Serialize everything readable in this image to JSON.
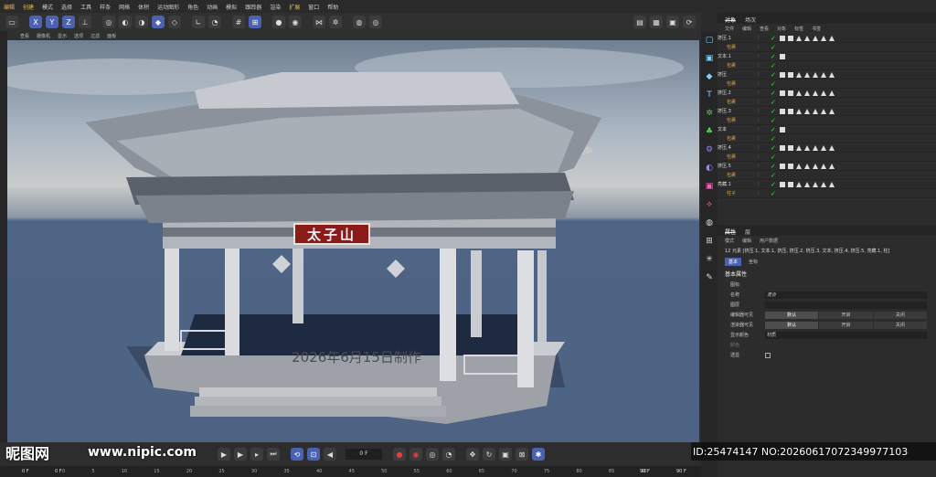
{
  "menubar": [
    "编辑",
    "创建",
    "模式",
    "选择",
    "工具",
    "样条",
    "网格",
    "体积",
    "运动图形",
    "角色",
    "动画",
    "模拟",
    "跟踪器",
    "渲染",
    "扩展",
    "窗口",
    "帮助"
  ],
  "viewport_menu": [
    "查看",
    "摄像机",
    "显示",
    "选项",
    "过滤",
    "面板"
  ],
  "scene": {
    "plaque_text": "太子山",
    "caption": "2026年6月15日制作"
  },
  "object_panel": {
    "tabs": [
      "对象",
      "场次"
    ],
    "menu": [
      "文件",
      "编辑",
      "查看",
      "对象",
      "标签",
      "书签"
    ],
    "rows": [
      {
        "name": "挤压.1",
        "type": "parent"
      },
      {
        "name": "包裹",
        "type": "child"
      },
      {
        "name": "文本.1",
        "type": "parent"
      },
      {
        "name": "包裹",
        "type": "child"
      },
      {
        "name": "挤压",
        "type": "parent"
      },
      {
        "name": "包裹",
        "type": "child"
      },
      {
        "name": "挤压.2",
        "type": "parent"
      },
      {
        "name": "包裹",
        "type": "child"
      },
      {
        "name": "挤压.3",
        "type": "parent"
      },
      {
        "name": "包裹",
        "type": "child"
      },
      {
        "name": "文本",
        "type": "parent"
      },
      {
        "name": "包裹",
        "type": "child"
      },
      {
        "name": "挤压.4",
        "type": "parent"
      },
      {
        "name": "包裹",
        "type": "child"
      },
      {
        "name": "挤压.5",
        "type": "parent"
      },
      {
        "name": "包裹",
        "type": "child"
      },
      {
        "name": "亮藏.1",
        "type": "parent"
      },
      {
        "name": "柱子",
        "type": "child"
      }
    ]
  },
  "attr_panel": {
    "tabs": [
      "属性",
      "层"
    ],
    "menu": [
      "模式",
      "编辑",
      "用户数据"
    ],
    "selection": "12 元素 [挤压.1, 文本.1, 挤压, 挤压.2, 挤压.3, 文本, 挤压.4, 挤压.5, 亮藏.1, 柱]",
    "subtabs": [
      "基本",
      "坐标"
    ],
    "section": "基本属性",
    "subsection": "图标",
    "fields": {
      "name_label": "名称",
      "name_value": "混合",
      "layer_label": "图层",
      "editor_vis_label": "编辑器可见",
      "render_vis_label": "渲染器可见",
      "options": [
        "默认",
        "开启",
        "关闭"
      ],
      "color_label": "显示颜色",
      "color_value": "材质",
      "color_sub": "颜色",
      "xray_label": "透显"
    }
  },
  "timeline": {
    "frame": "0 F",
    "start": "0 F",
    "current": "0 F",
    "end": "90 F",
    "end2": "90 F",
    "ticks": [
      "0",
      "5",
      "10",
      "15",
      "20",
      "25",
      "30",
      "35",
      "40",
      "45",
      "50",
      "55",
      "60",
      "65",
      "70",
      "75",
      "80",
      "85",
      "90"
    ]
  },
  "watermark": {
    "logo": "昵图网",
    "url": "www.nipic.com",
    "id_line": "ID:25474147 NO:20260617072349977103"
  },
  "colors": {
    "accent": "#4a62b0",
    "plaque": "#8b1a1a",
    "check": "#4fd04f"
  }
}
